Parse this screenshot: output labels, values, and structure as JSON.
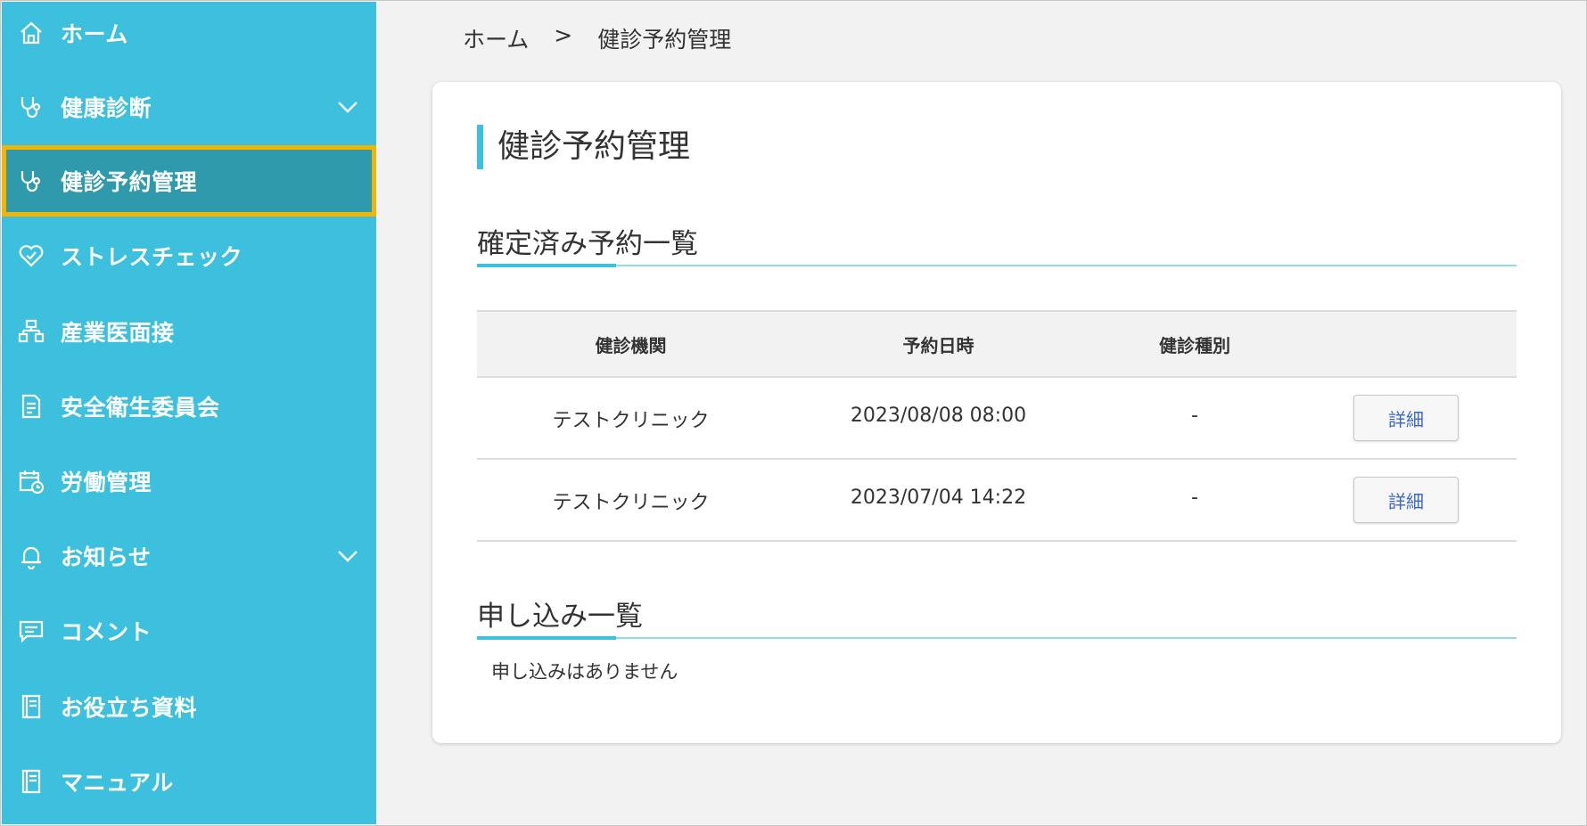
{
  "breadcrumb": {
    "home": "ホーム",
    "separator": ">",
    "current": "健診予約管理"
  },
  "sidebar": {
    "items": [
      {
        "label": "ホーム",
        "icon": "home-icon"
      },
      {
        "label": "健康診断",
        "icon": "stethoscope-icon",
        "expandable": true
      },
      {
        "label": "健診予約管理",
        "icon": "stethoscope-icon",
        "active": true
      },
      {
        "label": "ストレスチェック",
        "icon": "heart-icon"
      },
      {
        "label": "産業医面接",
        "icon": "org-chart-icon"
      },
      {
        "label": "安全衛生委員会",
        "icon": "document-icon"
      },
      {
        "label": "労働管理",
        "icon": "calendar-clock-icon"
      },
      {
        "label": "お知らせ",
        "icon": "bell-icon",
        "expandable": true
      },
      {
        "label": "コメント",
        "icon": "comment-icon"
      },
      {
        "label": "お役立ち資料",
        "icon": "book-icon"
      },
      {
        "label": "マニュアル",
        "icon": "book-icon"
      }
    ]
  },
  "main": {
    "title": "健診予約管理",
    "confirmed": {
      "title": "確定済み予約一覧",
      "columns": [
        "健診機関",
        "予約日時",
        "健診種別"
      ],
      "rows": [
        {
          "institution": "テストクリニック",
          "datetime": "2023/08/08 08:00",
          "type": "-",
          "button": "詳細"
        },
        {
          "institution": "テストクリニック",
          "datetime": "2023/07/04 14:22",
          "type": "-",
          "button": "詳細"
        }
      ]
    },
    "applications": {
      "title": "申し込み一覧",
      "empty_message": "申し込みはありません"
    }
  },
  "colors": {
    "sidebar": "#3cc0dd",
    "active_bg": "#2f9aac",
    "active_border": "#f5b400",
    "accent": "#3cc0dd",
    "link": "#3a67c7"
  }
}
